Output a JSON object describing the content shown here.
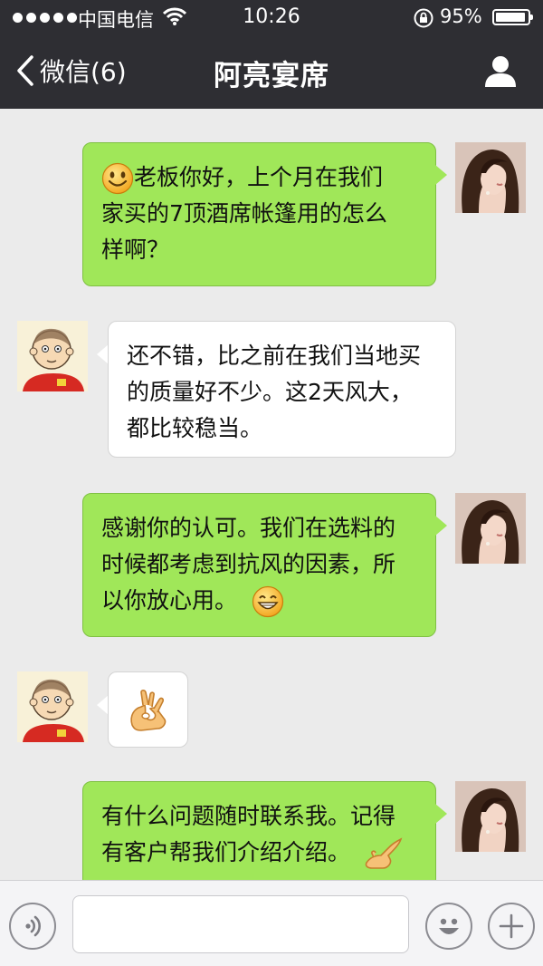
{
  "status_bar": {
    "carrier": "中国电信",
    "time": "10:26",
    "battery_pct": "95%",
    "battery_level": 0.95
  },
  "nav": {
    "back_label": "微信(6)",
    "title": "阿亮宴席"
  },
  "messages": [
    {
      "sender": "me",
      "lines": [
        "老板你好，上个月在我们",
        "家买的7顶酒席帐篷用的怎么",
        "样啊？"
      ],
      "emoji_lead": "smile"
    },
    {
      "sender": "other",
      "lines": [
        "还不错，比之前在我们当地买",
        "的质量好不少。这2天风大，",
        "都比较稳当。"
      ]
    },
    {
      "sender": "me",
      "lines": [
        "感谢你的认可。我们在选料的",
        "时候都考虑到抗风的因素，所",
        "以你放心用。"
      ],
      "emoji_trail": "grin"
    },
    {
      "sender": "other",
      "lines": [],
      "emoji_only": "ok-hand"
    },
    {
      "sender": "me",
      "lines": [
        "有什么问题随时联系我。记得",
        "有客户帮我们介绍介绍。"
      ],
      "emoji_trail": "pointing-hand"
    }
  ],
  "input": {
    "placeholder": "",
    "value": ""
  },
  "icons": {
    "voice": "voice-icon",
    "emoji": "emoji-icon",
    "plus": "plus-icon",
    "profile": "profile-icon",
    "back": "chevron-left-icon"
  },
  "colors": {
    "nav_bg": "#2e2e33",
    "chat_bg": "#ebebeb",
    "bubble_me": "#a0e759",
    "bubble_other": "#ffffff"
  }
}
